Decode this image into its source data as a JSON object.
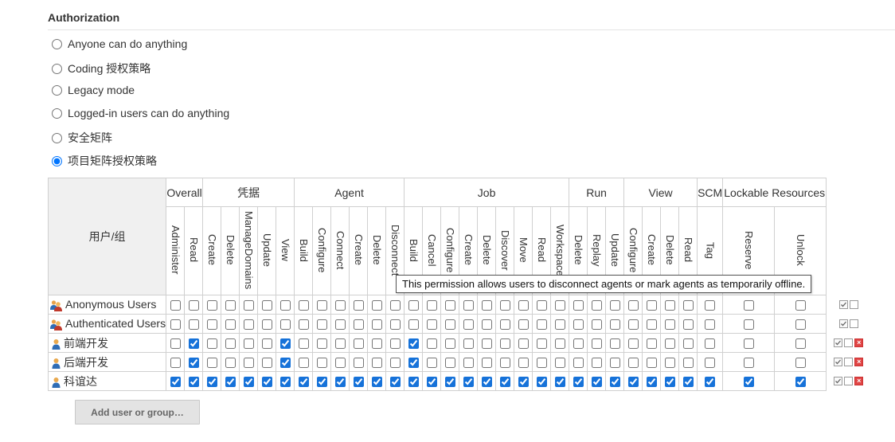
{
  "section": {
    "title": "Authorization"
  },
  "strategies": [
    {
      "label": "Anyone can do anything",
      "checked": false
    },
    {
      "label": "Coding 授权策略",
      "checked": false
    },
    {
      "label": "Legacy mode",
      "checked": false
    },
    {
      "label": "Logged-in users can do anything",
      "checked": false
    },
    {
      "label": "安全矩阵",
      "checked": false
    },
    {
      "label": "项目矩阵授权策略",
      "checked": true
    }
  ],
  "matrix": {
    "user_header": "用户/组",
    "groups": [
      "Overall",
      "凭据",
      "Agent",
      "Job",
      "Run",
      "View",
      "SCM",
      "Lockable Resources"
    ],
    "permissions": {
      "overall": [
        "Administer",
        "Read"
      ],
      "credentials": [
        "Create",
        "Delete",
        "ManageDomains",
        "Update",
        "View"
      ],
      "agent": [
        "Build",
        "Configure",
        "Connect",
        "Create",
        "Delete",
        "Disconnect"
      ],
      "job": [
        "Build",
        "Cancel",
        "Configure",
        "Create",
        "Delete",
        "Discover",
        "Move",
        "Read",
        "Workspace"
      ],
      "run": [
        "Delete",
        "Replay",
        "Update"
      ],
      "view": [
        "Configure",
        "Create",
        "Delete",
        "Read"
      ],
      "scm": [
        "Tag"
      ],
      "lockable": [
        "Reserve",
        "Unlock"
      ]
    },
    "rows": [
      {
        "name": "Anonymous Users",
        "icon": "group-users-icon"
      },
      {
        "name": "Authenticated Users",
        "icon": "group-users-icon"
      },
      {
        "name": "前端开发",
        "icon": "user-icon"
      },
      {
        "name": "后端开发",
        "icon": "user-icon"
      },
      {
        "name": "科谊达",
        "icon": "user-icon"
      }
    ]
  },
  "tooltip": {
    "text": "This permission allows users to disconnect agents or mark agents as temporarily offline."
  },
  "add_button": {
    "label": "Add user or group…"
  },
  "colors": {
    "checkbox_accent": "#1672d9",
    "header_gray": "#f0f0f0",
    "delete_red": "#e04545"
  }
}
